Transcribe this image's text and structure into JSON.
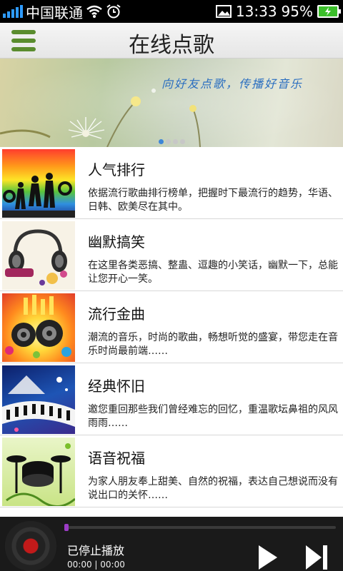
{
  "status_bar": {
    "carrier": "中国联通",
    "time": "13:33",
    "battery": "95%"
  },
  "header": {
    "title": "在线点歌"
  },
  "banner": {
    "slogan": "向好友点歌，传播好音乐",
    "dot_count": 4,
    "active_dot": 0
  },
  "list": [
    {
      "title": "人气排行",
      "desc": "依据流行歌曲排行榜单，把握时下最流行的趋势，华语、日韩、欧美尽在其中。"
    },
    {
      "title": "幽默搞笑",
      "desc": "在这里各类恶搞、整蛊、逗趣的小笑话，幽默一下，总能让您开心一笑。"
    },
    {
      "title": "流行金曲",
      "desc": "潮流的音乐，时尚的歌曲，畅想听觉的盛宴，带您走在音乐时尚最前端……"
    },
    {
      "title": "经典怀旧",
      "desc": "邀您重回那些我们曾经难忘的回忆，重温歌坛鼻祖的风风雨雨……"
    },
    {
      "title": "语音祝福",
      "desc": "为家人朋友奉上甜美、自然的祝福，表达自己想说而没有说出口的关怀……"
    }
  ],
  "player": {
    "status": "已停止播放",
    "time": "00:00 | 00:00",
    "progress": 0
  },
  "colors": {
    "accent_green": "#5a8c2e",
    "dot_active": "#3c86d8",
    "progress_knob": "#9c3cc6"
  }
}
